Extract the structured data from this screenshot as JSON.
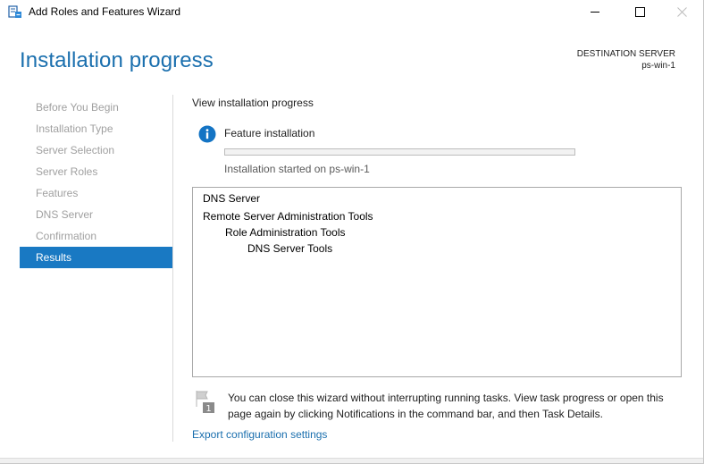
{
  "window": {
    "title": "Add Roles and Features Wizard",
    "icon": "server-manager-icon",
    "controls": [
      "minimize-icon",
      "maximize-icon",
      "close-icon"
    ]
  },
  "header": {
    "page_title": "Installation progress",
    "destination_label": "DESTINATION SERVER",
    "destination_server": "ps-win-1"
  },
  "nav": {
    "items": [
      {
        "label": "Before You Begin"
      },
      {
        "label": "Installation Type"
      },
      {
        "label": "Server Selection"
      },
      {
        "label": "Server Roles"
      },
      {
        "label": "Features"
      },
      {
        "label": "DNS Server"
      },
      {
        "label": "Confirmation"
      },
      {
        "label": "Results",
        "active": true
      }
    ]
  },
  "content": {
    "heading": "View installation progress",
    "status_icon": "info-icon",
    "feature_label": "Feature installation",
    "progress_fraction": 0.0,
    "started_text": "Installation started on ps-win-1",
    "results": [
      {
        "text": "DNS Server",
        "level": 0
      },
      {
        "text": "Remote Server Administration Tools",
        "level": 0
      },
      {
        "text": "Role Administration Tools",
        "level": 1
      },
      {
        "text": "DNS Server Tools",
        "level": 2
      }
    ],
    "note_icon": "notification-flag-icon",
    "note_text": "You can close this wizard without interrupting running tasks. View task progress or open this page again by clicking Notifications in the command bar, and then Task Details.",
    "export_link": "Export configuration settings"
  },
  "colors": {
    "accent": "#1979c3",
    "title_blue": "#1a6fae",
    "disabled_text": "#a0a0a0"
  }
}
